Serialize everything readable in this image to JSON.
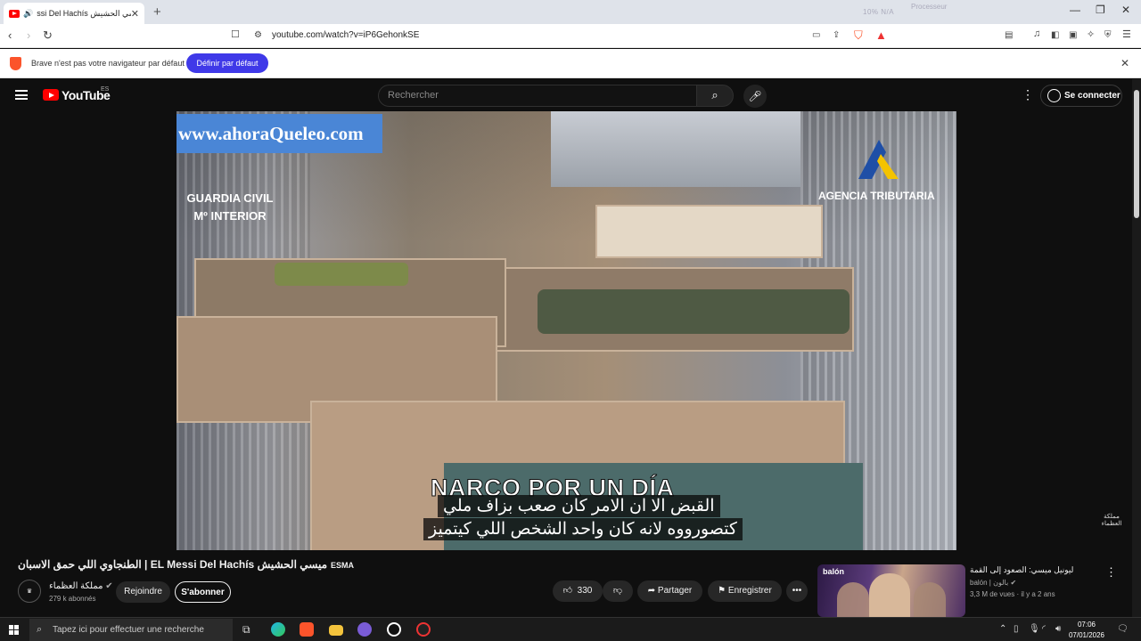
{
  "browser": {
    "tab_title": "ssi Del Hachís ميسي الحشيش",
    "new_tab": "+",
    "close_tab": "✕",
    "url": "youtube.com/watch?v=iP6GehonkSE",
    "sysmon_left": "10%   N/A",
    "sysmon_right": "Processeur",
    "infobar_message": "Brave n'est pas votre navigateur par défaut",
    "infobar_button": "Définir par défaut"
  },
  "youtube": {
    "logo_text": "YouTube",
    "region": "ES",
    "search_placeholder": "Rechercher",
    "signin_label": "Se connecter"
  },
  "video": {
    "watermark_site": "www.ahoraQueleo.com",
    "watermark_left": "GUARDIA CIVIL\nMº INTERIOR",
    "watermark_right": "AGENCIA TRIBUTARIA",
    "overlay_title": "NARCO POR UN DÍA",
    "subtitle_line1": "القبض الا ان الامر كان صعب بزاف ملي",
    "subtitle_line2": "كتصورووه لانه كان واحد الشخص اللي كيتميز",
    "corner_logo": "مملكة العظماء"
  },
  "details": {
    "title": "الطنجاوي اللي حمق الاسبان | EL Messi Del Hachís ميسي الحشيش",
    "title_tag": "ESMA",
    "channel_name": "مملكة العظماء",
    "channel_subs": "279 k abonnés",
    "join_label": "Rejoindre",
    "subscribe_label": "S'abonner",
    "like_count": "330",
    "share_label": "Partager",
    "save_label": "Enregistrer",
    "more_label": "•••"
  },
  "recommendation": {
    "brand": "balón",
    "title": "ليونيل ميسي: الصعود إلى القمة",
    "channel": "balón | بالون",
    "meta": "3,3 M de vues · il y a 2 ans"
  },
  "taskbar": {
    "search_placeholder": "Tapez ici pour effectuer une recherche",
    "time": "07:06",
    "date": "07/01/2026"
  },
  "colors": {
    "brave_accent": "#3f39e8",
    "youtube_red": "#ff0000",
    "dark_bg": "#0f0f0f"
  }
}
